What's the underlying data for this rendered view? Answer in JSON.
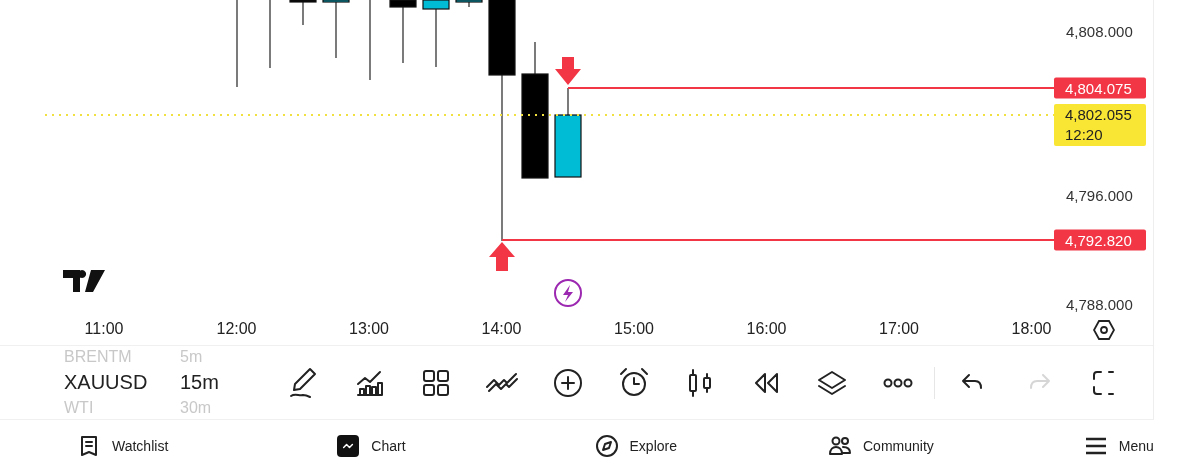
{
  "price_axis": {
    "labels": [
      "4,808.000",
      "4,796.000",
      "4,788.000"
    ]
  },
  "price_tags": [
    {
      "kind": "alert",
      "price": "4,804.075"
    },
    {
      "kind": "last",
      "price": "4,802.055",
      "countdown": "12:20"
    },
    {
      "kind": "alert",
      "price": "4,792.820"
    }
  ],
  "time_axis": {
    "labels": [
      "11:00",
      "12:00",
      "13:00",
      "14:00",
      "15:00",
      "16:00",
      "17:00",
      "18:00"
    ]
  },
  "symbol_picker": {
    "items": [
      {
        "symbol": "BRENTM",
        "interval": "5m",
        "selected": false
      },
      {
        "symbol": "XAUUSD",
        "interval": "15m",
        "selected": true
      },
      {
        "symbol": "WTI",
        "interval": "30m",
        "selected": false
      }
    ]
  },
  "toolbar": {
    "tools": [
      {
        "kind": "draw"
      },
      {
        "kind": "indicators"
      },
      {
        "kind": "layouts"
      },
      {
        "kind": "compare"
      },
      {
        "kind": "add"
      },
      {
        "kind": "alert"
      },
      {
        "kind": "candles"
      },
      {
        "kind": "replay"
      },
      {
        "kind": "layers"
      },
      {
        "kind": "more"
      }
    ],
    "undo": {
      "disabled": false
    },
    "redo": {
      "disabled": true
    }
  },
  "nav": [
    {
      "kind": "watchlist",
      "label": "Watchlist",
      "selected": false
    },
    {
      "kind": "chart",
      "label": "Chart",
      "selected": true
    },
    {
      "kind": "explore",
      "label": "Explore",
      "selected": false
    },
    {
      "kind": "community",
      "label": "Community",
      "selected": false
    },
    {
      "kind": "menu",
      "label": "Menu",
      "selected": false
    }
  ]
}
